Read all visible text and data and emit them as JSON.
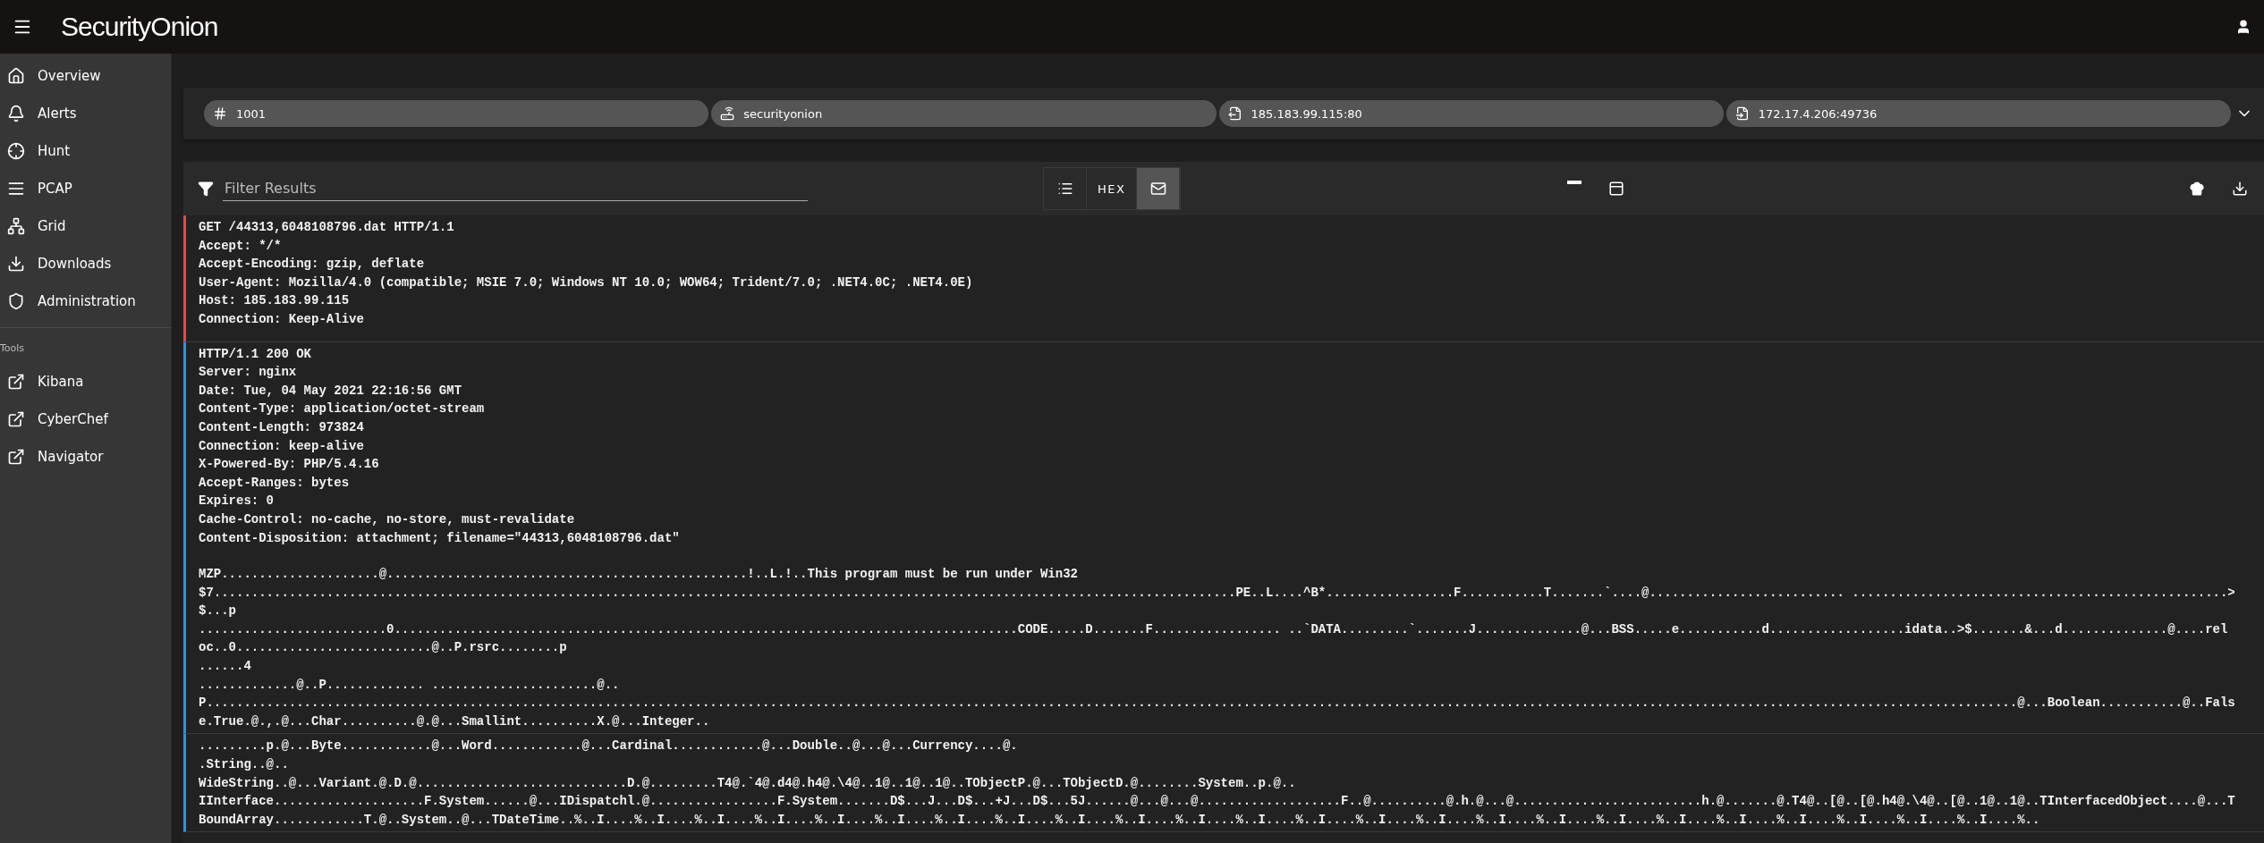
{
  "app_bar": {
    "logo": "SecurityOnion"
  },
  "sidebar": {
    "items": [
      {
        "kind": "home",
        "label": "Overview"
      },
      {
        "kind": "bell",
        "label": "Alerts"
      },
      {
        "kind": "crosshair",
        "label": "Hunt"
      },
      {
        "kind": "lines",
        "label": "PCAP"
      },
      {
        "kind": "network",
        "label": "Grid"
      },
      {
        "kind": "download",
        "label": "Downloads"
      },
      {
        "kind": "shield",
        "label": "Administration"
      }
    ],
    "tools_heading": "Tools",
    "tools": [
      {
        "label": "Kibana"
      },
      {
        "label": "CyberChef"
      },
      {
        "label": "Navigator"
      }
    ]
  },
  "chips": [
    {
      "kind": "id",
      "label": "1001"
    },
    {
      "kind": "sensor",
      "label": "securityonion"
    },
    {
      "kind": "source",
      "label": "185.183.99.115:80"
    },
    {
      "kind": "destination",
      "label": "172.17.4.206:49736"
    }
  ],
  "toolbar": {
    "filter": {
      "placeholder": "Filter Results"
    },
    "view_modes": [
      {
        "kind": "list",
        "selected": false
      },
      {
        "kind": "hex",
        "label": "HEX",
        "selected": false
      },
      {
        "kind": "text",
        "selected": true
      }
    ]
  },
  "blocks": [
    {
      "kind": "request",
      "headers": [
        "GET /44313,6048108796.dat HTTP/1.1",
        "Accept: */*",
        "Accept-Encoding: gzip, deflate",
        "User-Agent: Mozilla/4.0 (compatible; MSIE 7.0; Windows NT 10.0; WOW64; Trident/7.0; .NET4.0C; .NET4.0E)",
        "Host: 185.183.99.115",
        "Connection: Keep-Alive"
      ]
    },
    {
      "kind": "response",
      "headers": [
        "HTTP/1.1 200 OK",
        "Server: nginx",
        "Date: Tue, 04 May 2021 22:16:56 GMT",
        "Content-Type: application/octet-stream",
        "Content-Length: 973824",
        "Connection: keep-alive",
        "X-Powered-By: PHP/5.4.16",
        "Accept-Ranges: bytes",
        "Expires: 0",
        "Cache-Control: no-cache, no-store, must-revalidate",
        "Content-Disposition: attachment; filename=\"44313,6048108796.dat\""
      ],
      "body": [
        "MZP.....................@................................................!..L.!..This program must be run under Win32",
        "$7........................................................................................................................................PE..L....^B*.................F...........T.......`....@.......................... ..................................................>",
        "$...p",
        ".........................0...................................................................................CODE.....D.......F................. ..`DATA.........`.......J..............@...BSS.....e...........d..................idata..>$.......&...d..............@....rel",
        "oc..0..........................@..P.rsrc........p",
        "......4",
        ".............@..P............. ......................@..",
        "P.................................................................................................................................................................................................................................................@...Boolean...........@..Fals",
        "e.True.@.,.@...Char..........@.@...Smallint..........X.@...Integer.."
      ]
    },
    {
      "kind": "response",
      "body": [
        ".........p.@...Byte............@...Word............@...Cardinal............@...Double..@...@...Currency....@.",
        ".String..@..",
        "WideString..@...Variant.@.D.@............................D.@.........T4@.`4@.d4@.h4@.\\4@..1@..1@..1@..TObjectP.@...TObjectD.@........System..p.@..",
        "IInterface....................F.System......@...IDispatchl.@.................F.System.......D$...J...D$...+J...D$...5J......@...@...@...................F..@..........@.h.@...@.........................h.@.......@.T4@..[@..[@.h4@.\\4@..[@..1@..1@..TInterfacedObject....@...T",
        "BoundArray............T.@..System..@...TDateTime..%..I....%..I....%..I....%..I....%..I....%..I....%..I....%..I....%..I....%..I....%..I....%..I....%..I....%..I....%..I....%..I....%..I....%..I....%..I....%..I....%..I....%..I....%..I....%..I....%.."
      ]
    }
  ]
}
